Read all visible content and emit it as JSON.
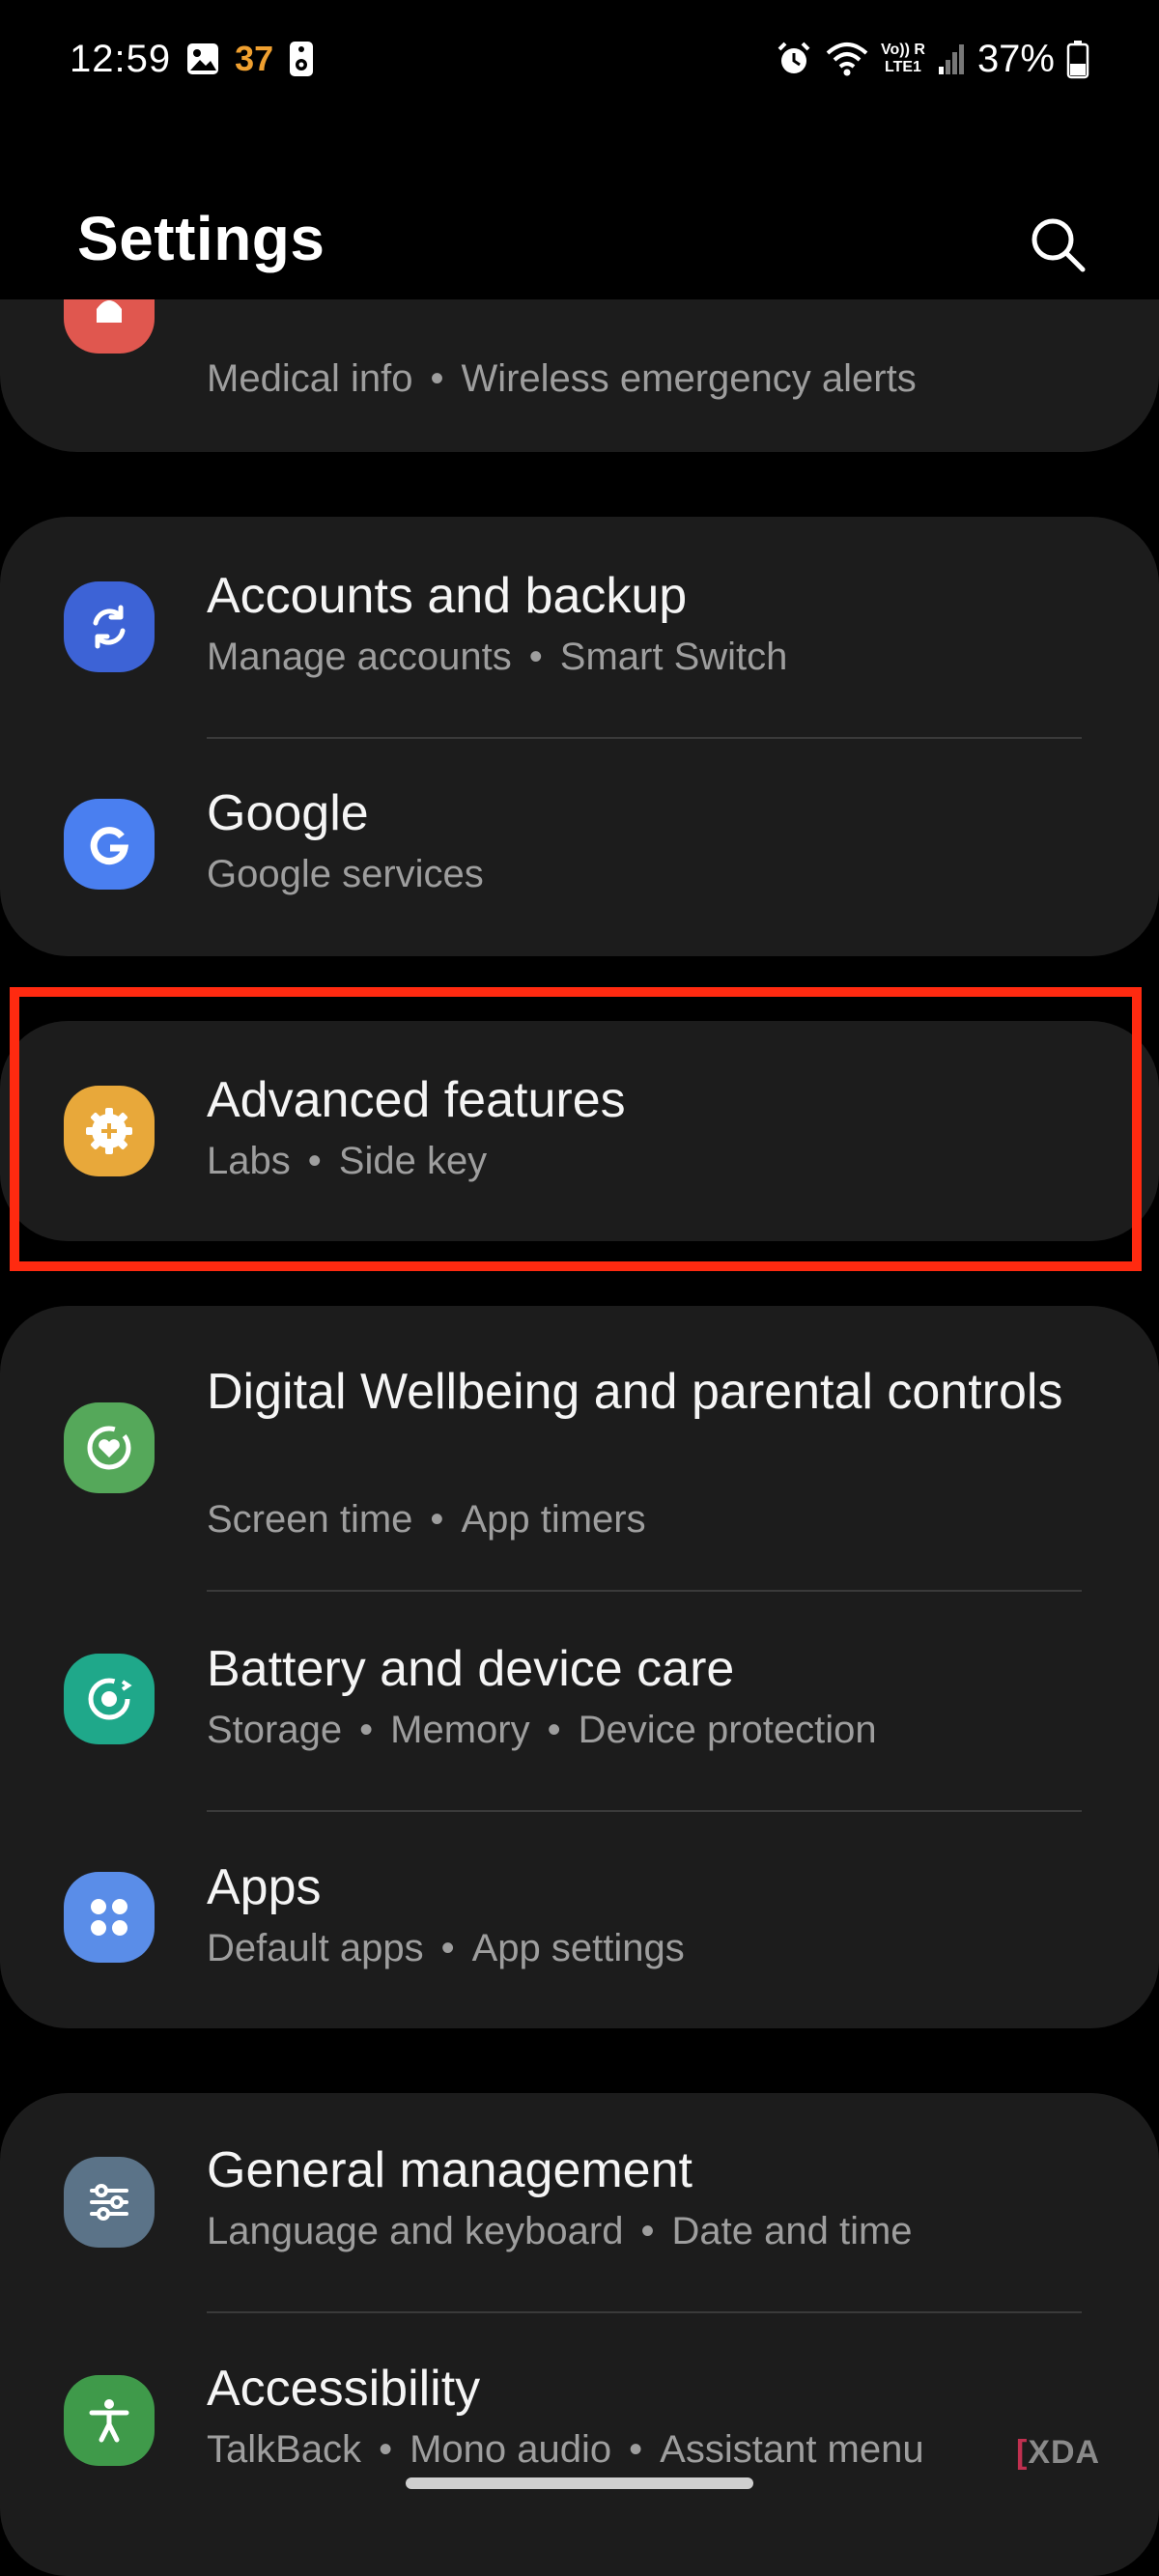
{
  "status_bar": {
    "time": "12:59",
    "notification_count": "37",
    "battery_percent": "37%",
    "icons": [
      "gallery-icon",
      "device-icon",
      "alarm-icon",
      "wifi-icon",
      "volte-icon",
      "signal-icon",
      "battery-icon"
    ],
    "volte_top": "Vo)) R",
    "volte_bottom": "LTE1"
  },
  "header": {
    "title": "Settings",
    "search_icon": "search-icon"
  },
  "items": {
    "safety": {
      "subtitle_parts": [
        "Medical info",
        "Wireless emergency alerts"
      ],
      "icon_color": "#e0574f"
    },
    "accounts": {
      "title": "Accounts and backup",
      "subtitle_parts": [
        "Manage accounts",
        "Smart Switch"
      ],
      "icon_color": "#3d63d6"
    },
    "google": {
      "title": "Google",
      "subtitle_parts": [
        "Google services"
      ],
      "icon_color": "#4a7ff0"
    },
    "advanced": {
      "title": "Advanced features",
      "subtitle_parts": [
        "Labs",
        "Side key"
      ],
      "icon_color": "#e8a83a"
    },
    "wellbeing": {
      "title": "Digital Wellbeing and parental controls",
      "subtitle_parts": [
        "Screen time",
        "App timers"
      ],
      "icon_color": "#55a85a"
    },
    "battery": {
      "title": "Battery and device care",
      "subtitle_parts": [
        "Storage",
        "Memory",
        "Device protection"
      ],
      "icon_color": "#1fa88a"
    },
    "apps": {
      "title": "Apps",
      "subtitle_parts": [
        "Default apps",
        "App settings"
      ],
      "icon_color": "#5a8de8"
    },
    "general": {
      "title": "General management",
      "subtitle_parts": [
        "Language and keyboard",
        "Date and time"
      ],
      "icon_color": "#5b7388"
    },
    "accessibility": {
      "title": "Accessibility",
      "subtitle_parts": [
        "TalkBack",
        "Mono audio",
        "Assistant menu"
      ],
      "icon_color": "#3f9a4a"
    }
  },
  "separator": "•",
  "highlight_color": "#ff2a10",
  "watermark": {
    "mark": "[",
    "text": "XDA"
  }
}
